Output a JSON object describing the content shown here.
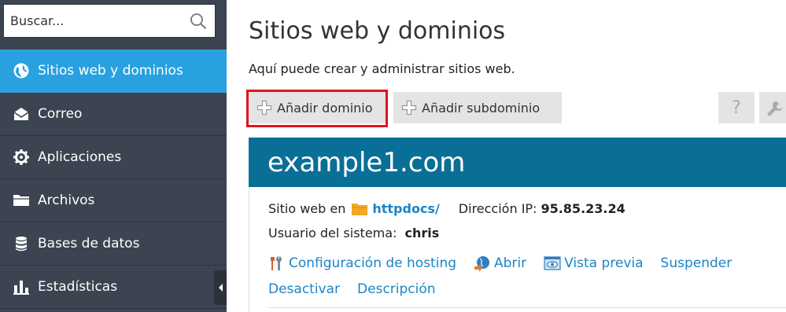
{
  "sidebar": {
    "search_placeholder": "Buscar...",
    "items": [
      {
        "label": "Sitios web y dominios",
        "icon": "globe-icon",
        "active": true
      },
      {
        "label": "Correo",
        "icon": "envelope-icon",
        "active": false
      },
      {
        "label": "Aplicaciones",
        "icon": "gear-icon",
        "active": false
      },
      {
        "label": "Archivos",
        "icon": "folder-icon",
        "active": false
      },
      {
        "label": "Bases de datos",
        "icon": "database-icon",
        "active": false
      },
      {
        "label": "Estadísticas",
        "icon": "bar-chart-icon",
        "active": false
      }
    ]
  },
  "main": {
    "title": "Sitios web y dominios",
    "description": "Aquí puede crear y administrar sitios web.",
    "toolbar": {
      "add_domain": "Añadir dominio",
      "add_subdomain": "Añadir subdominio",
      "help": "?"
    },
    "domain": {
      "name": "example1.com",
      "website_in_label": "Sitio web en",
      "docroot": "httpdocs/",
      "ip_label": "Dirección IP:",
      "ip": "95.85.23.24",
      "user_label": "Usuario del sistema:",
      "user": "chris",
      "actions": {
        "hosting": "Configuración de hosting",
        "open": "Abrir",
        "preview": "Vista previa",
        "suspend": "Suspender",
        "deactivate": "Desactivar",
        "description": "Descripción"
      }
    }
  },
  "colors": {
    "sidebar_bg": "#3b4450",
    "active_item": "#29a1e0",
    "card_header": "#0a6f97",
    "link": "#1b85c4",
    "highlight": "#e0141e"
  }
}
